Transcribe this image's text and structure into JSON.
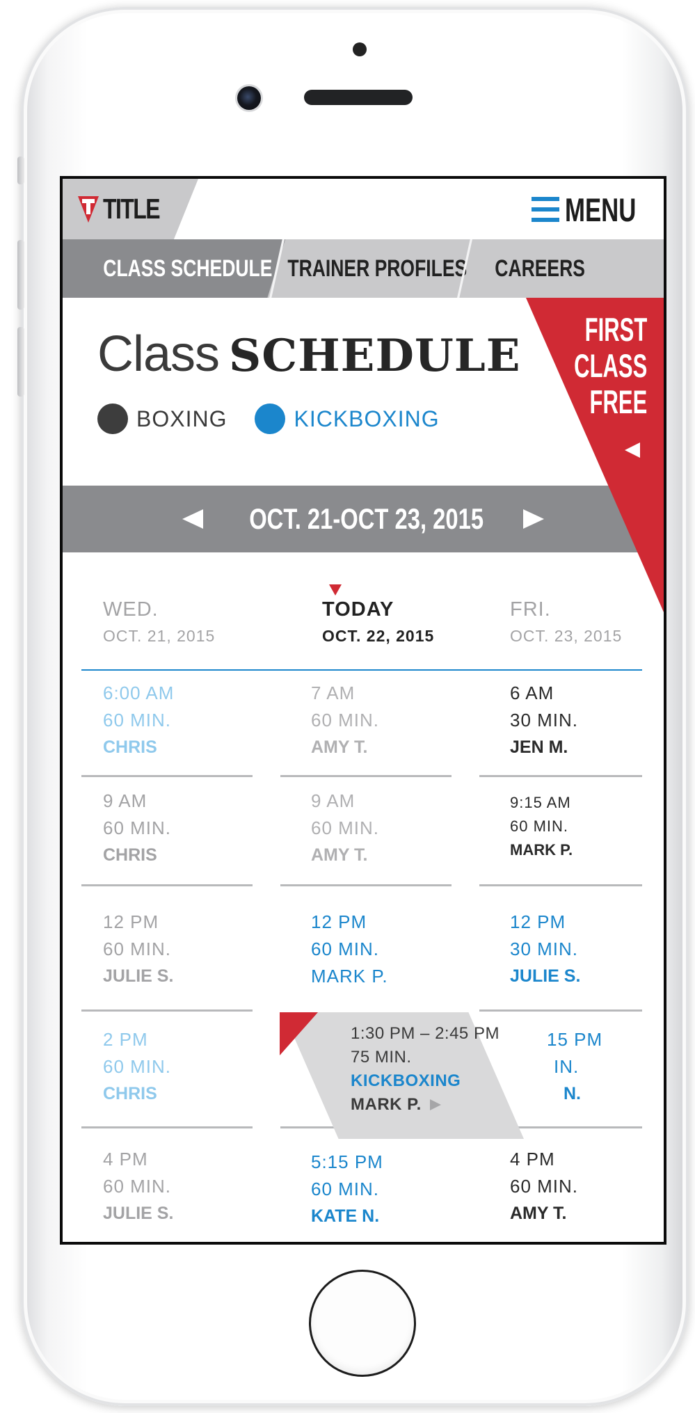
{
  "colors": {
    "accent_blue": "#1b86cc",
    "light_blue": "#8fc9ec",
    "red": "#d02a34",
    "bar_gray": "#8a8b8e",
    "tab_bg": "#c9c9cb",
    "boxing_dark": "#3d3d3d",
    "muted_text": "#a3a3a5",
    "dark_text": "#222222"
  },
  "header": {
    "logo_text": "TITLE",
    "menu_label": "MENU"
  },
  "tabs": [
    {
      "label": "CLASS SCHEDULE",
      "active": true
    },
    {
      "label": "TRAINER PROFILES",
      "active": false
    },
    {
      "label": "CAREERS",
      "active": false
    }
  ],
  "page": {
    "title_light": "Class",
    "title_bold": "SCHEDULE"
  },
  "legend": [
    {
      "label": "BOXING",
      "color": "#3d3d3d"
    },
    {
      "label": "KICKBOXING",
      "color": "#1b86cc"
    }
  ],
  "promo": {
    "line1": "FIRST",
    "line2": "CLASS",
    "line3": "FREE"
  },
  "date_nav": {
    "range": "OCT. 21-OCT 23, 2015"
  },
  "days": [
    {
      "name": "WED.",
      "date": "OCT. 21, 2015"
    },
    {
      "name": "TODAY",
      "date": "OCT. 22, 2015"
    },
    {
      "name": "FRI.",
      "date": "OCT. 23, 2015"
    }
  ],
  "schedule": {
    "rows": [
      [
        {
          "time": "6:00 AM",
          "duration": "60 MIN.",
          "trainer": "CHRIS"
        },
        {
          "time": "7 AM",
          "duration": "60 MIN.",
          "trainer": "AMY T."
        },
        {
          "time": "6 AM",
          "duration": "30 MIN.",
          "trainer": "JEN M."
        }
      ],
      [
        {
          "time": "9 AM",
          "duration": "60 MIN.",
          "trainer": "CHRIS"
        },
        {
          "time": "9 AM",
          "duration": "60 MIN.",
          "trainer": "AMY T."
        },
        {
          "time": "9:15 AM",
          "duration": "60 MIN.",
          "trainer": "MARK P."
        }
      ],
      [
        {
          "time": "12 PM",
          "duration": "60 MIN.",
          "trainer": "JULIE S."
        },
        {
          "time": "12 PM",
          "duration": "60 MIN.",
          "trainer": "MARK P."
        },
        {
          "time": "12 PM",
          "duration": "30 MIN.",
          "trainer": "JULIE S."
        }
      ],
      [
        {
          "time": "2 PM",
          "duration": "60 MIN.",
          "trainer": "CHRIS"
        },
        {
          "time": "",
          "duration": "",
          "trainer": ""
        },
        {
          "time": "15 PM",
          "duration": "IN.",
          "trainer": "N."
        }
      ],
      [
        {
          "time": "4 PM",
          "duration": "60 MIN.",
          "trainer": "JULIE S."
        },
        {
          "time": "5:15 PM",
          "duration": "60 MIN.",
          "trainer": "KATE N."
        },
        {
          "time": "4 PM",
          "duration": "60 MIN.",
          "trainer": "AMY T."
        }
      ]
    ]
  },
  "popup": {
    "time_range": "1:30 PM – 2:45 PM",
    "duration": "75 MIN.",
    "class_type": "KICKBOXING",
    "trainer": "MARK P."
  }
}
